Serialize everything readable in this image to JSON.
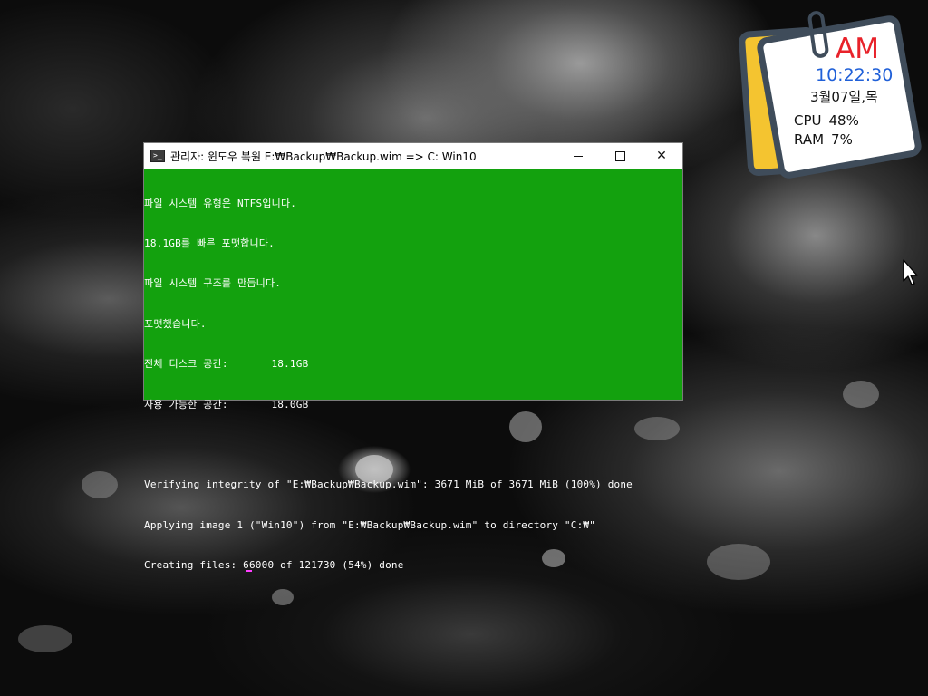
{
  "console": {
    "title": "관리자:  윈도우 복원 E:₩Backup₩Backup.wim => C: Win10",
    "buttons": {
      "minimize": "—",
      "maximize": "☐",
      "close": "✕"
    },
    "lines": [
      "파일 시스템 유형은 NTFS입니다.",
      "18.1GB를 빠른 포맷합니다.",
      "파일 시스템 구조를 만듭니다.",
      "포맷했습니다.",
      "전체 디스크 공간:       18.1GB",
      "사용 가능한 공간:       18.0GB",
      "",
      "Verifying integrity of \"E:₩Backup₩Backup.wim\": 3671 MiB of 3671 MiB (100%) done",
      "Applying image 1 (\"Win10\") from \"E:₩Backup₩Backup.wim\" to directory \"C:₩\"",
      "Creating files: 66000 of 121730 (54%) done"
    ],
    "colors": {
      "background": "#13a10e",
      "text": "#ffffff"
    }
  },
  "widget": {
    "ampm": "AM",
    "time": "10:22:30",
    "date": "3월07일,목",
    "cpu_label": "CPU",
    "cpu_value": "48%",
    "ram_label": "RAM",
    "ram_value": "7%"
  }
}
